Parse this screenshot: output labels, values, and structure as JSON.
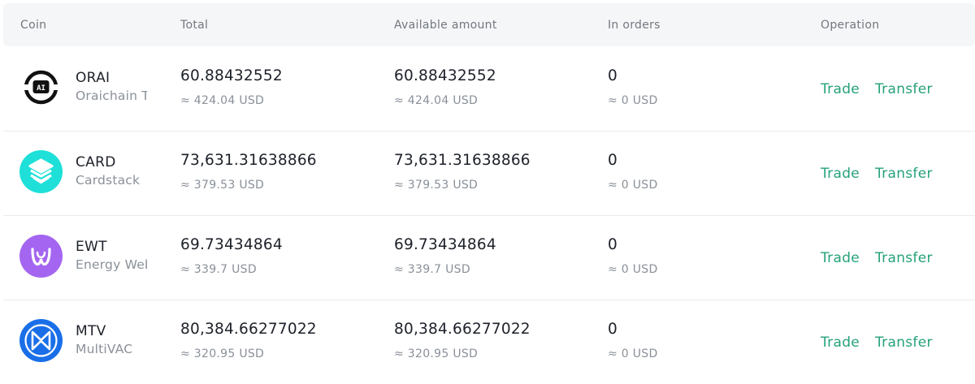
{
  "header": {
    "coin": "Coin",
    "total": "Total",
    "available": "Available amount",
    "in_orders": "In orders",
    "operation": "Operation"
  },
  "rows": [
    {
      "symbol": "ORAI",
      "name": "Oraichain T.",
      "icon": "oraichain-logo-icon",
      "icon_color": "#ffffff",
      "total": "60.88432552",
      "total_usd": "≈ 424.04 USD",
      "available": "60.88432552",
      "available_usd": "≈ 424.04 USD",
      "in_orders": "0",
      "in_orders_usd": "≈ 0 USD",
      "trade": "Trade",
      "transfer": "Transfer"
    },
    {
      "symbol": "CARD",
      "name": "Cardstack",
      "icon": "cardstack-logo-icon",
      "icon_color": "#1ee0d8",
      "total": "73,631.31638866",
      "total_usd": "≈ 379.53 USD",
      "available": "73,631.31638866",
      "available_usd": "≈ 379.53 USD",
      "in_orders": "0",
      "in_orders_usd": "≈ 0 USD",
      "trade": "Trade",
      "transfer": "Transfer"
    },
    {
      "symbol": "EWT",
      "name": "Energy Web",
      "icon": "energy-web-logo-icon",
      "icon_color": "#a466f0",
      "total": "69.73434864",
      "total_usd": "≈ 339.7 USD",
      "available": "69.73434864",
      "available_usd": "≈ 339.7 USD",
      "in_orders": "0",
      "in_orders_usd": "≈ 0 USD",
      "trade": "Trade",
      "transfer": "Transfer"
    },
    {
      "symbol": "MTV",
      "name": "MultiVAC",
      "icon": "multivac-logo-icon",
      "icon_color": "#1a6fe8",
      "total": "80,384.66277022",
      "total_usd": "≈ 320.95 USD",
      "available": "80,384.66277022",
      "available_usd": "≈ 320.95 USD",
      "in_orders": "0",
      "in_orders_usd": "≈ 0 USD",
      "trade": "Trade",
      "transfer": "Transfer"
    }
  ],
  "colors": {
    "accent": "#26a17b",
    "header_bg": "#f5f6f7",
    "muted_text": "#8a9099"
  }
}
